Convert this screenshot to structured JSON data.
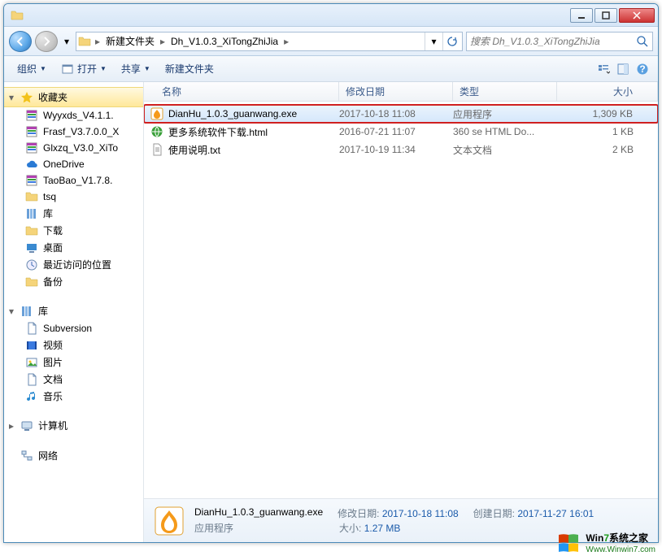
{
  "titlebar": {
    "title": ""
  },
  "winbuttons": {
    "min": "minimize",
    "max": "maximize",
    "close": "close"
  },
  "nav": {
    "crumbs": [
      "新建文件夹",
      "Dh_V1.0.3_XiTongZhiJia"
    ]
  },
  "search": {
    "placeholder": "搜索 Dh_V1.0.3_XiTongZhiJia"
  },
  "toolbar": {
    "organize": "组织",
    "open": "打开",
    "share": "共享",
    "newfolder": "新建文件夹"
  },
  "sidebar": {
    "favorites": {
      "label": "收藏夹",
      "items": [
        {
          "label": "Wyyxds_V4.1.1.",
          "ico": "rar"
        },
        {
          "label": "Frasf_V3.7.0.0_X",
          "ico": "rar"
        },
        {
          "label": "Glxzq_V3.0_XiTo",
          "ico": "rar"
        },
        {
          "label": "OneDrive",
          "ico": "cloud"
        },
        {
          "label": "TaoBao_V1.7.8.",
          "ico": "rar"
        },
        {
          "label": "tsq",
          "ico": "folder"
        },
        {
          "label": "库",
          "ico": "lib"
        },
        {
          "label": "下载",
          "ico": "folder"
        },
        {
          "label": "桌面",
          "ico": "desktop"
        },
        {
          "label": "最近访问的位置",
          "ico": "recent"
        },
        {
          "label": "备份",
          "ico": "folder"
        }
      ]
    },
    "libraries": {
      "label": "库",
      "items": [
        {
          "label": "Subversion",
          "ico": "doc"
        },
        {
          "label": "视频",
          "ico": "video"
        },
        {
          "label": "图片",
          "ico": "pic"
        },
        {
          "label": "文档",
          "ico": "doc"
        },
        {
          "label": "音乐",
          "ico": "music"
        }
      ]
    },
    "computer": {
      "label": "计算机"
    },
    "network": {
      "label": "网络"
    }
  },
  "columns": {
    "name": "名称",
    "date": "修改日期",
    "type": "类型",
    "size": "大小"
  },
  "rows": [
    {
      "name": "DianHu_1.0.3_guanwang.exe",
      "date": "2017-10-18 11:08",
      "type": "应用程序",
      "size": "1,309 KB",
      "ico": "exe",
      "sel": true,
      "hl": true
    },
    {
      "name": "更多系统软件下载.html",
      "date": "2016-07-21 11:07",
      "type": "360 se HTML Do...",
      "size": "1 KB",
      "ico": "html"
    },
    {
      "name": "使用说明.txt",
      "date": "2017-10-19 11:34",
      "type": "文本文档",
      "size": "2 KB",
      "ico": "txt"
    }
  ],
  "details": {
    "name": "DianHu_1.0.3_guanwang.exe",
    "type": "应用程序",
    "mdate_label": "修改日期:",
    "mdate": "2017-10-18 11:08",
    "cdate_label": "创建日期:",
    "cdate": "2017-11-27 16:01",
    "size_label": "大小:",
    "size": "1.27 MB"
  },
  "watermark": {
    "cn_pre": "Win",
    "cn_num": "7",
    "cn_post": "系统之家",
    "en": "Www.Winwin7.com"
  }
}
